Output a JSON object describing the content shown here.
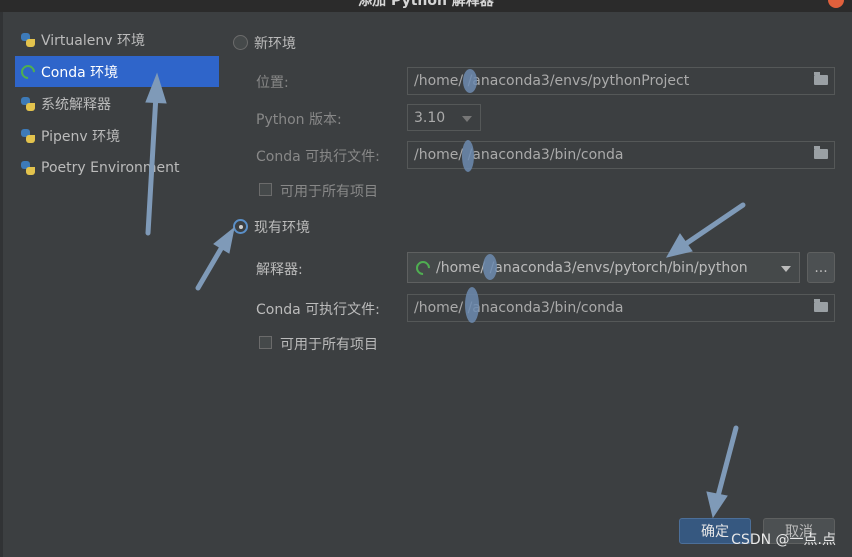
{
  "window": {
    "title": "添加 Python 解释器"
  },
  "sidebar": {
    "items": [
      {
        "label": "Virtualenv 环境",
        "icon": "python-icon",
        "selected": false
      },
      {
        "label": "Conda 环境",
        "icon": "conda-ring-icon",
        "selected": true
      },
      {
        "label": "系统解释器",
        "icon": "python-icon",
        "selected": false
      },
      {
        "label": "Pipenv 环境",
        "icon": "pipenv-icon",
        "selected": false
      },
      {
        "label": "Poetry Environment",
        "icon": "poetry-icon",
        "selected": false
      }
    ]
  },
  "new_env": {
    "radio_label": "新环境",
    "selected": false,
    "location_label": "位置:",
    "location_value": "/home/  /anaconda3/envs/pythonProject",
    "python_version_label": "Python 版本:",
    "python_version_value": "3.10",
    "conda_exec_label": "Conda 可执行文件:",
    "conda_exec_value": "/home/  /anaconda3/bin/conda",
    "all_projects_label": "可用于所有项目"
  },
  "existing_env": {
    "radio_label": "现有环境",
    "selected": true,
    "interpreter_label": "解释器:",
    "interpreter_value": "/home/  /anaconda3/envs/pytorch/bin/python",
    "more_button_label": "...",
    "conda_exec_label": "Conda 可执行文件:",
    "conda_exec_value": "/home/  /anaconda3/bin/conda",
    "all_projects_label": "可用于所有项目"
  },
  "footer": {
    "ok_label": "确定",
    "cancel_label": "取消"
  },
  "watermark": "CSDN @一点.点",
  "colors": {
    "accent": "#2f65ca",
    "background": "#3c3f41",
    "annotation_arrow": "#7f9ab8"
  }
}
